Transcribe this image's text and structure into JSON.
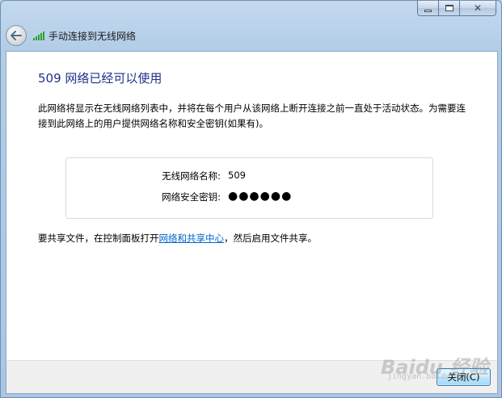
{
  "window": {
    "header_title": "手动连接到无线网络",
    "minimize_icon": "minimize-icon",
    "maximize_icon": "maximize-icon",
    "close_icon": "close-icon",
    "back_icon": "back-arrow-icon",
    "network_icon": "wireless-signal-icon"
  },
  "main": {
    "title": "509 网络已经可以使用",
    "description": "此网络将显示在无线网络列表中，并将在每个用户从该网络上断开连接之前一直处于活动状态。为需要连接到此网络上的用户提供网络名称和安全密钥(如果有)。",
    "network_name_label": "无线网络名称:",
    "network_name_value": "509",
    "security_key_label": "网络安全密钥:",
    "security_key_value": "●●●●●●",
    "share_prefix": "要共享文件，在控制面板打开",
    "share_link": "网络和共享中心",
    "share_suffix": "，然后启用文件共享。"
  },
  "footer": {
    "close_button_label": "关闭(C)"
  },
  "watermark": {
    "text": "Baidu 经验",
    "sub": "jingyan.baidu.com"
  },
  "colors": {
    "title": "#1e3287",
    "link": "#0066cc",
    "signal": "#2aa32a"
  }
}
